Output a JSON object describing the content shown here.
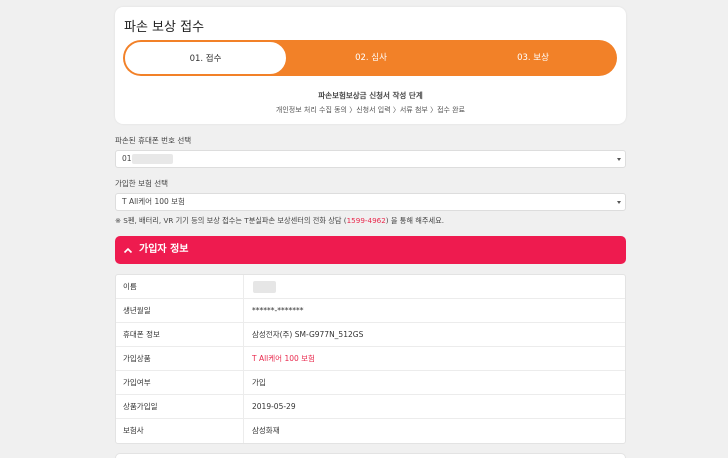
{
  "header": {
    "title": "파손 보상 접수",
    "steps": [
      {
        "label": "01. 접수",
        "active": true
      },
      {
        "label": "02. 심사",
        "active": false
      },
      {
        "label": "03. 보상",
        "active": false
      }
    ],
    "subtitle": "파손보험보상금 신청서 작성 단계",
    "process": "개인정보 처리 수집 동의 〉신청서 입력 〉서류 첨부 〉접수 완료"
  },
  "phone_select": {
    "label": "파손된 휴대폰 번호 선택",
    "value": "01"
  },
  "insurance_select": {
    "label": "가입한 보험 선택",
    "value": "T All케어 100 보험"
  },
  "notice": {
    "prefix": "※ S펜, 배터리, VR 기기 등의 보상 접수는 T분실파손 보상센터의 전화 상담 (",
    "phone": "1599-4962",
    "suffix": ") 을 통해 해주세요."
  },
  "section": {
    "title": "가입자 정보"
  },
  "info_rows": [
    {
      "label": "이름",
      "value": ""
    },
    {
      "label": "생년월일",
      "value": "******-*******"
    },
    {
      "label": "휴대폰 정보",
      "value": "삼성전자(주) SM-G977N_512GS"
    },
    {
      "label": "가입상품",
      "value": "T All케어 100 보험"
    },
    {
      "label": "가입여부",
      "value": "가입"
    },
    {
      "label": "상품가입일",
      "value": "2019-05-29"
    },
    {
      "label": "보험사",
      "value": "삼성화재"
    }
  ],
  "colors": {
    "accent_orange": "#f28128",
    "accent_pink": "#ee1b4f",
    "highlight_red": "#e9294d"
  }
}
